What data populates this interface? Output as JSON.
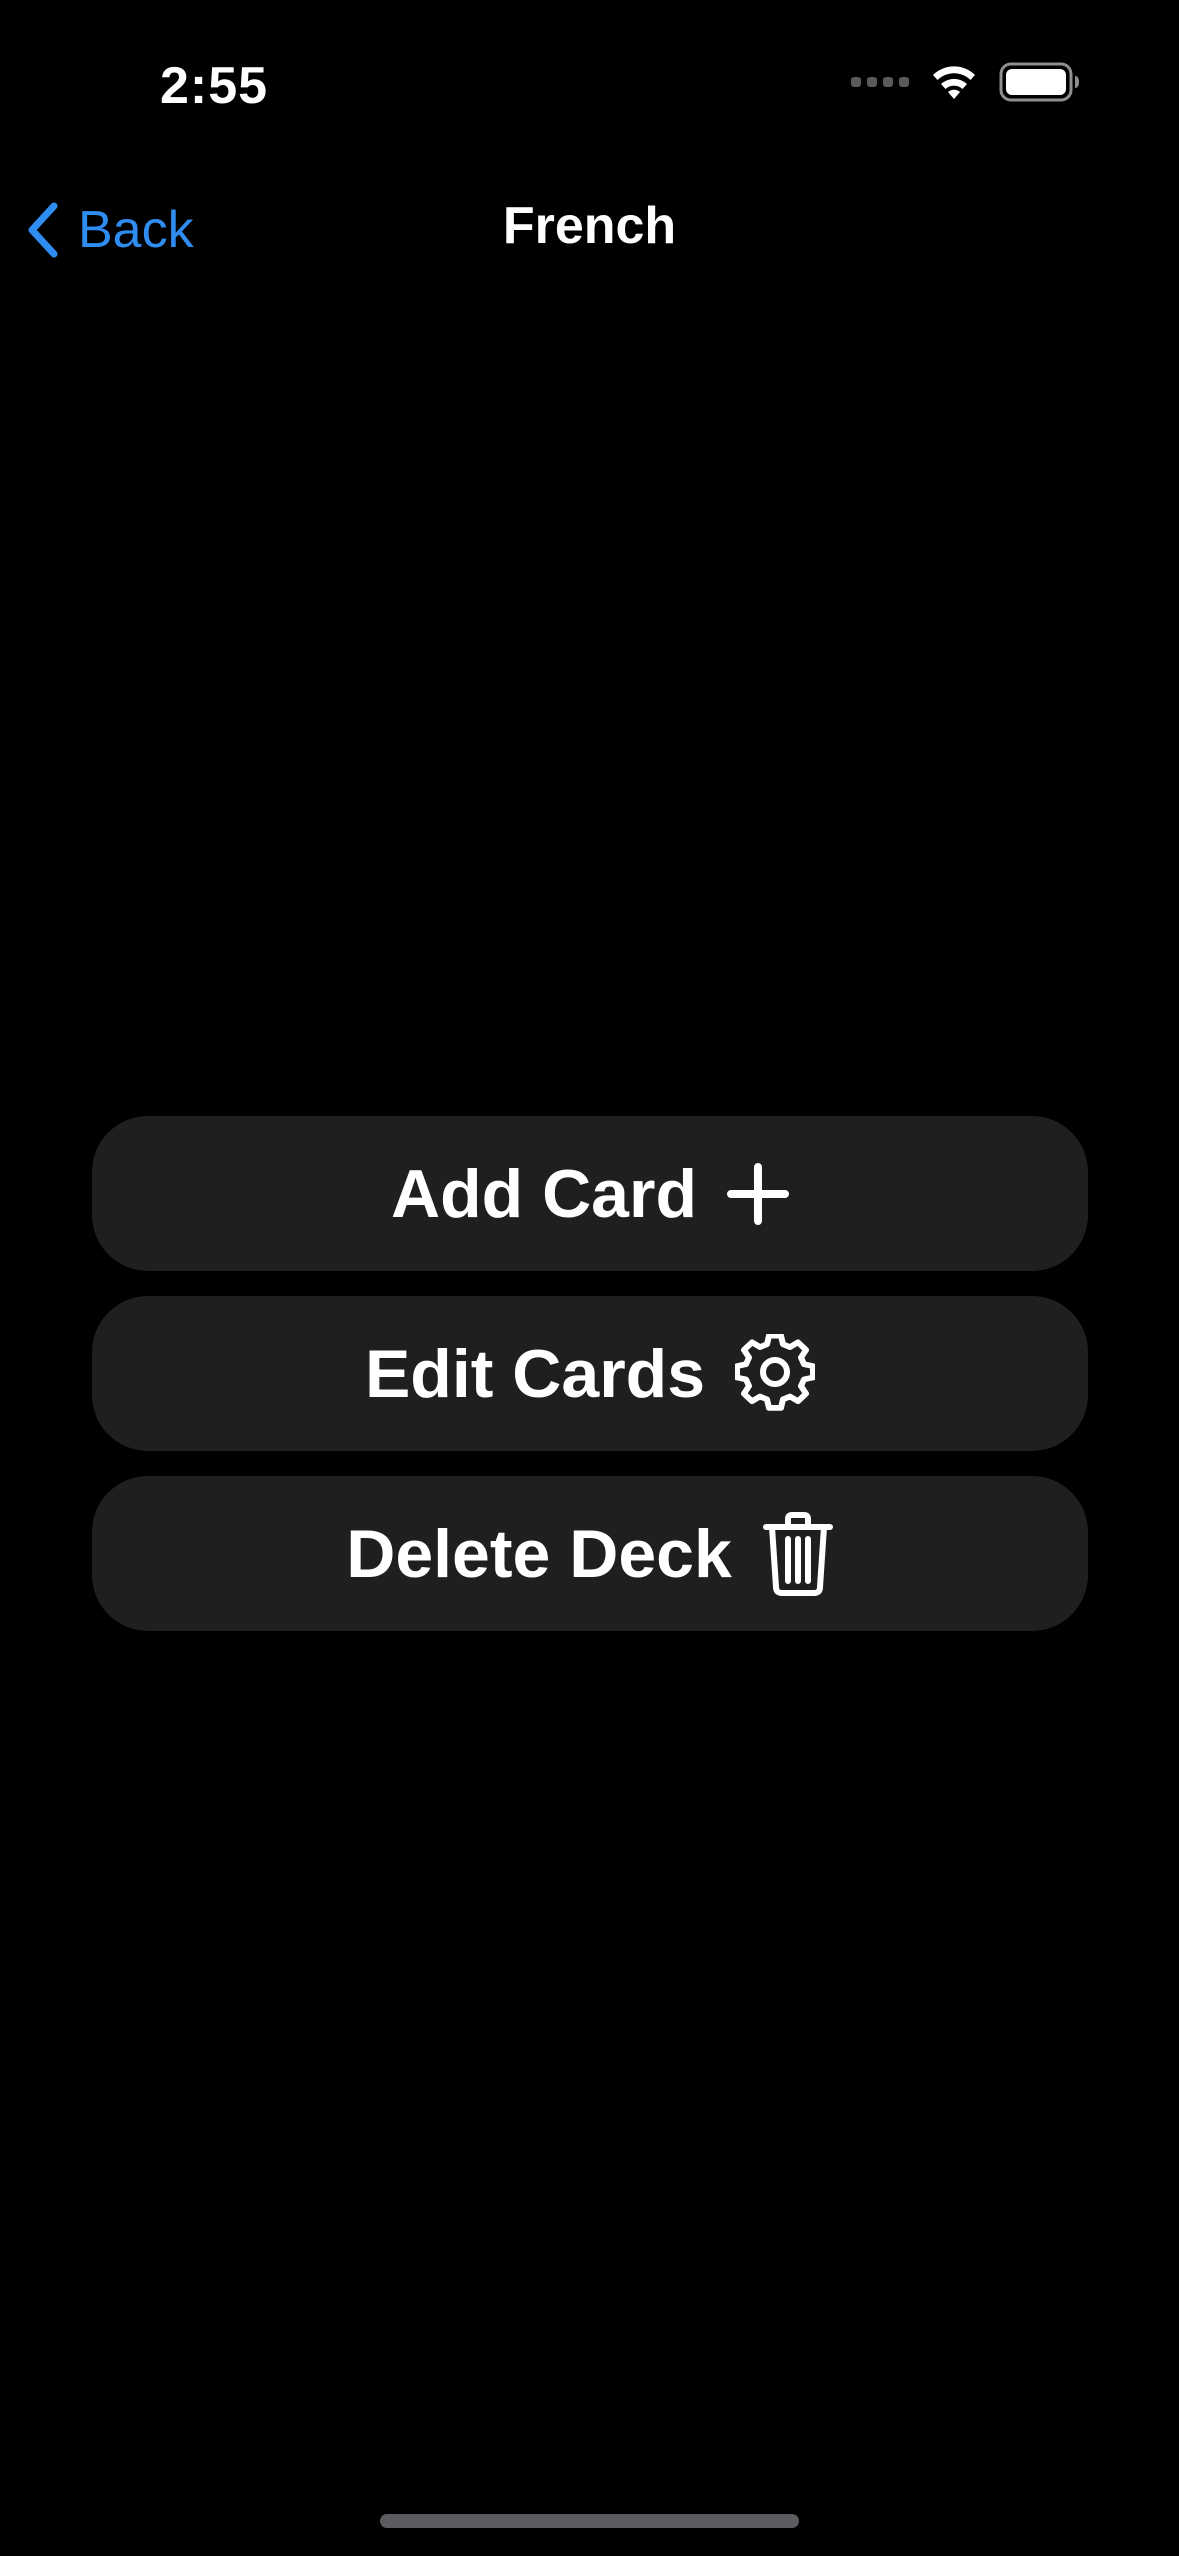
{
  "status_bar": {
    "time": "2:55",
    "signal_icon": "cellular-signal-icon",
    "wifi_icon": "wifi-icon",
    "battery_icon": "battery-icon"
  },
  "nav": {
    "back_label": "Back",
    "back_icon": "chevron-left-icon",
    "title": "French"
  },
  "actions": {
    "add_card": {
      "label": "Add Card",
      "icon": "plus-icon"
    },
    "edit_cards": {
      "label": "Edit Cards",
      "icon": "gear-icon"
    },
    "delete_deck": {
      "label": "Delete Deck",
      "icon": "trash-icon"
    }
  },
  "colors": {
    "background": "#000000",
    "accent": "#2f8cf0",
    "button_background": "#1f1f21",
    "text": "#ffffff"
  }
}
